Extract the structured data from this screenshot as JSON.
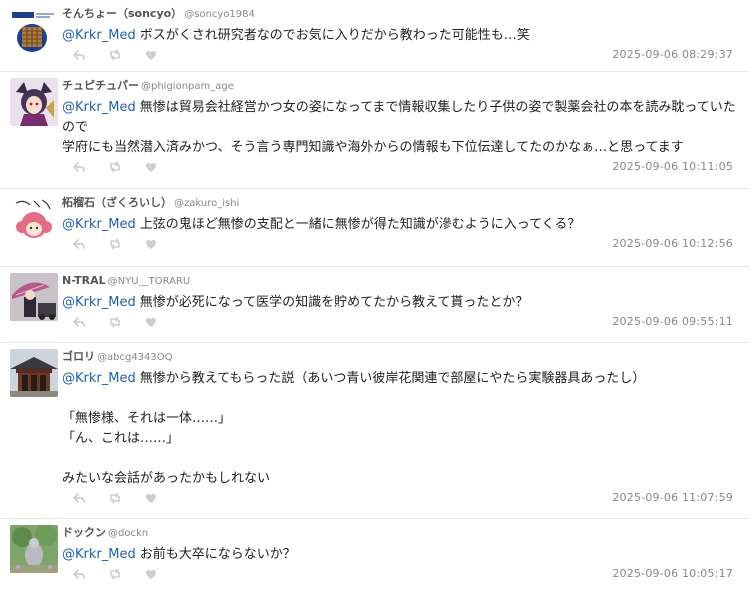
{
  "replies": [
    {
      "name": "そんちょー（soncyo）",
      "handle": "@soncyo1984",
      "mention": "@Krkr_Med",
      "text": "ボスがくされ研究者なのでお気に入りだから教わった可能性も…笑",
      "time": "2025-09-06 08:29:37",
      "avatar_icon": "shop-logo-icon"
    },
    {
      "name": "チュピチュパー",
      "handle": "@phigionpam_age",
      "mention": "@Krkr_Med",
      "text": "無惨は貿易会社経営かつ女の姿になってまで情報収集したり子供の姿で製薬会社の本を読み耽っていたので\n学府にも当然潜入済みかつ、そう言う専門知識や海外からの情報も下位伝達してたのかなぁ…と思ってます",
      "time": "2025-09-06 10:11:05",
      "avatar_icon": "anime-character-icon"
    },
    {
      "name": "柘榴石（ざくろいし）",
      "handle": "@zakuro_ishi",
      "mention": "@Krkr_Med",
      "text": "上弦の鬼ほど無惨の支配と一緒に無惨が得た知識が滲むように入ってくる？",
      "time": "2025-09-06 10:12:56",
      "avatar_icon": "pink-hair-character-icon"
    },
    {
      "name": "N-TRAL",
      "handle": "@NYU__TORARU",
      "mention": "@Krkr_Med",
      "text": "無惨が必死になって医学の知識を貯めてたから教えて貰ったとか？",
      "time": "2025-09-06 09:55:11",
      "avatar_icon": "umbrella-figure-icon"
    },
    {
      "name": "ゴロリ",
      "handle": "@abcg4343OQ",
      "mention": "@Krkr_Med",
      "text": "無惨から教えてもらった説（あいつ青い彼岸花関連で部屋にやたら実験器具あったし）\n\n「無惨様、それは一体……」\n「ん、これは……」\n\nみたいな会話があったかもしれない",
      "time": "2025-09-06 11:07:59",
      "avatar_icon": "temple-building-icon"
    },
    {
      "name": "ドックン",
      "handle": "@dockn",
      "mention": "@Krkr_Med",
      "text": "お前も大卒にならないか？",
      "time": "2025-09-06 10:05:17",
      "avatar_icon": "garden-photo-icon"
    }
  ],
  "colors": {
    "mention": "#1f5fb0",
    "meta": "#888888",
    "action_icon": "#cfcfcf"
  }
}
